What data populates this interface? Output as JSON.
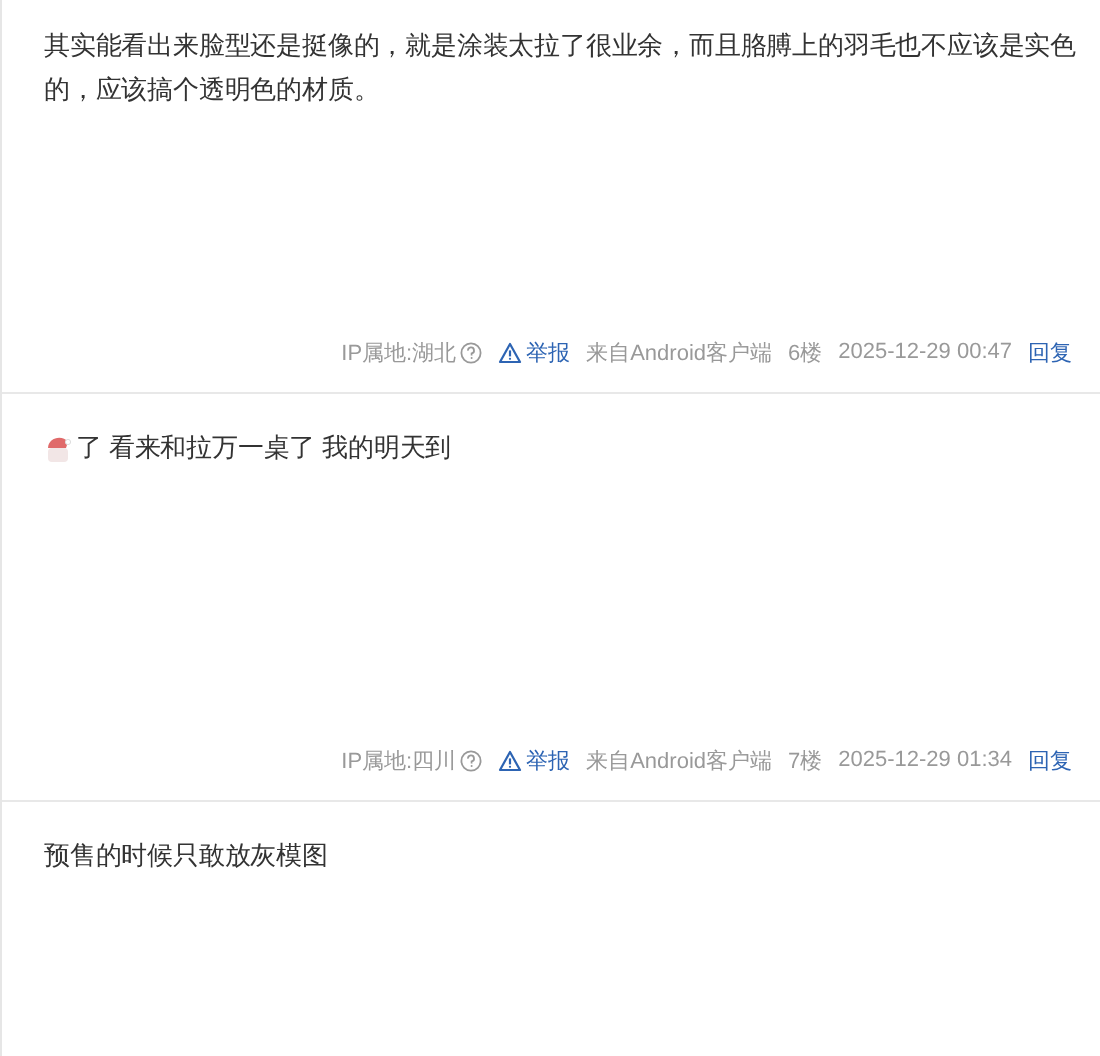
{
  "posts": [
    {
      "has_emoji": false,
      "text": "其实能看出来脸型还是挺像的，就是涂装太拉了很业余，而且胳膊上的羽毛也不应该是实色的，应该搞个透明色的材质。",
      "meta": {
        "ip": "IP属地:湖北",
        "report": "举报",
        "source": "来自Android客户端",
        "floor": "6楼",
        "time": "2025-12-29 00:47",
        "reply": "回复"
      }
    },
    {
      "has_emoji": true,
      "text": "了 看来和拉万一桌了 我的明天到",
      "meta": {
        "ip": "IP属地:四川",
        "report": "举报",
        "source": "来自Android客户端",
        "floor": "7楼",
        "time": "2025-12-29 01:34",
        "reply": "回复"
      }
    },
    {
      "has_emoji": false,
      "text": "预售的时候只敢放灰模图"
    }
  ]
}
